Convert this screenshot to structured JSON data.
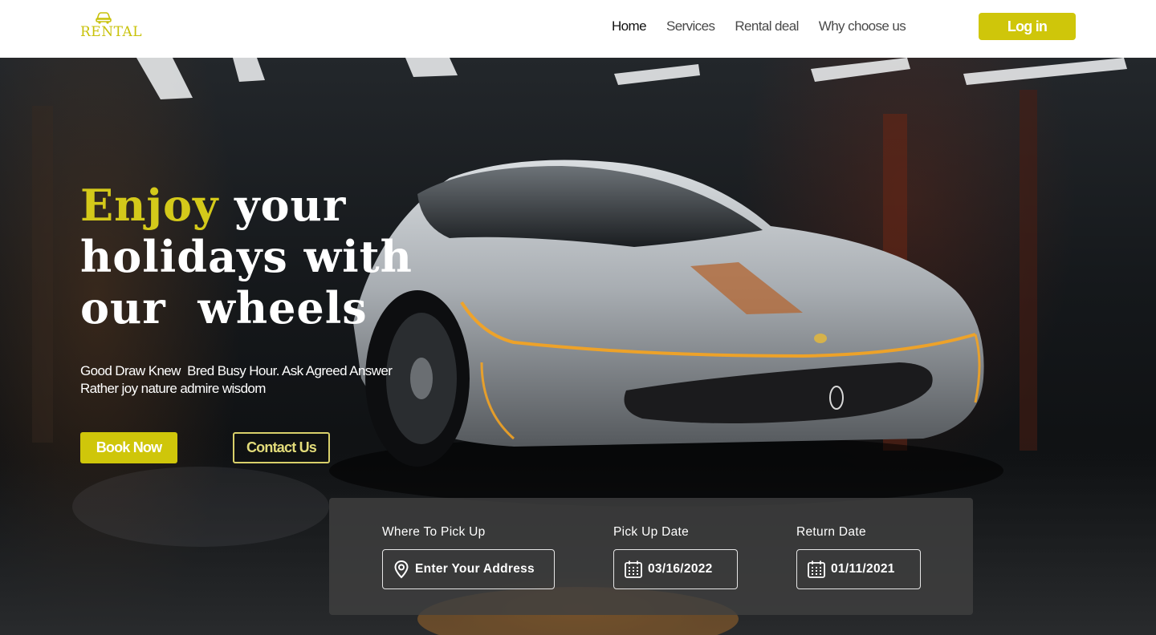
{
  "brand": {
    "logo_text": "RENTAL",
    "logo_icon": "car-icon",
    "accent_color": "#cfc60a"
  },
  "nav": {
    "items": [
      {
        "label": "Home",
        "active": true
      },
      {
        "label": "Services",
        "active": false
      },
      {
        "label": "Rental deal",
        "active": false
      },
      {
        "label": "Why choose us",
        "active": false
      }
    ],
    "login_label": "Log in"
  },
  "hero": {
    "headline_accent": "Enjoy",
    "headline_line1_rest": " your",
    "headline_line2": "holidays with",
    "headline_line3": "our  wheels",
    "subtext_line1": "Good Draw Knew  Bred Busy Hour. Ask Agreed Answer",
    "subtext_line2": "Rather joy nature admire wisdom",
    "book_label": "Book Now",
    "contact_label": "Contact Us"
  },
  "booking": {
    "pickup": {
      "label": "Where To Pick Up",
      "value": "Enter Your Address",
      "icon": "location-pin-icon"
    },
    "pickup_date": {
      "label": "Pick Up Date",
      "value": "03/16/2022",
      "icon": "calendar-icon"
    },
    "return_date": {
      "label": "Return Date",
      "value": "01/11/2021",
      "icon": "calendar-icon"
    }
  }
}
